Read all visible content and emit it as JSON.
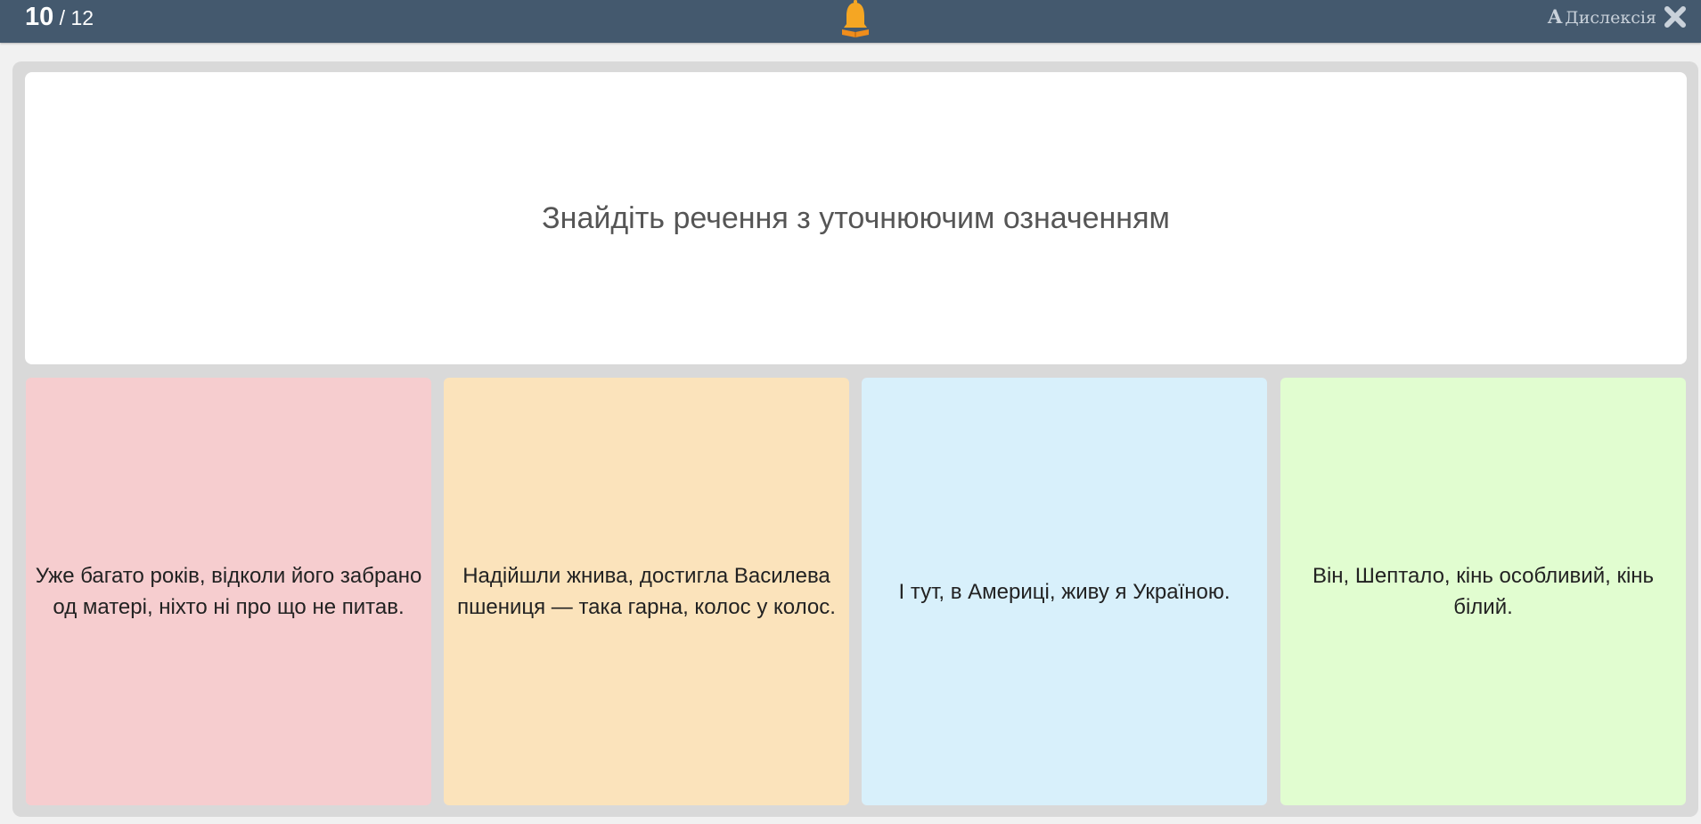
{
  "header": {
    "current": "10",
    "separator": " / ",
    "total": "12",
    "logo_icon": "bell-book-icon",
    "dyslexia_glyph": "A",
    "dyslexia_label": "Дислексія",
    "close_icon": "close-icon"
  },
  "question": {
    "text": "Знайдіть речення з уточнюючим означенням"
  },
  "answers": [
    {
      "text": "Уже багато років, відколи його забрано од матері, ніхто ні про що не питав.",
      "color": "#f6cdcf"
    },
    {
      "text": "Надійшли жнива, достигла Василева пшениця — така гарна, колос у колос.",
      "color": "#fbe3bb"
    },
    {
      "text": "І тут, в Америці, живу я Україною.",
      "color": "#d8f0fb"
    },
    {
      "text": "Він, Шептало, кінь особливий, кінь білий.",
      "color": "#e1fdd0"
    }
  ],
  "colors": {
    "topbar": "#44596e",
    "bell": "#f5a623"
  }
}
